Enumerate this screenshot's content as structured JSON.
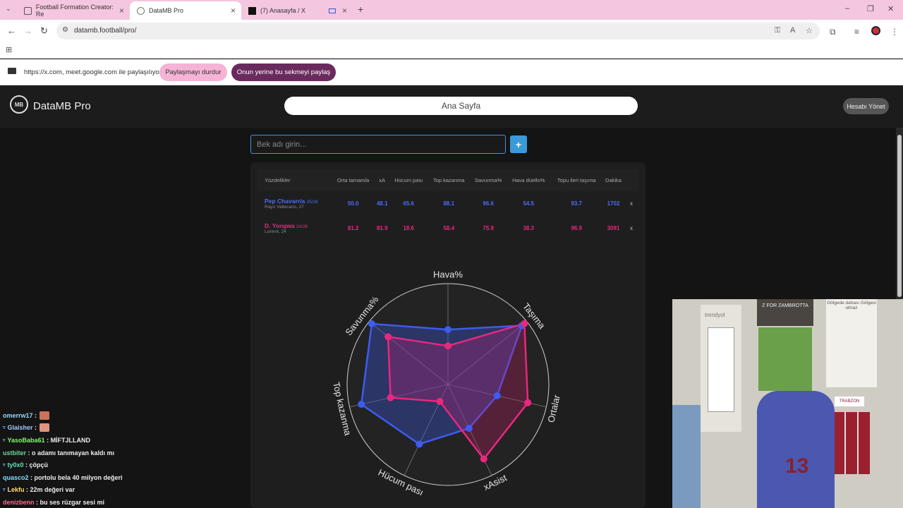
{
  "browser": {
    "tabs": [
      {
        "title": "Football Formation Creator: Re",
        "active": false
      },
      {
        "title": "DataMB Pro",
        "active": true
      },
      {
        "title": "(7) Anasayfa / X",
        "active": false
      }
    ],
    "url": "datamb.football/pro/",
    "share": {
      "message": "https://x.com, meet.google.com ile paylaşılıyor",
      "stop_label": "Paylaşmayı durdur",
      "share_this_label": "Onun yerine bu sekmeyi paylaş"
    }
  },
  "app": {
    "brand": "DataMB Pro",
    "logo_text": "MB",
    "home_label": "Ana Sayfa",
    "manage_label": "Hesabı Yönet",
    "search_placeholder": "Bek adı girin...",
    "add_label": "+"
  },
  "table": {
    "corner_label": "Yüzdelikler",
    "headers": [
      "Orta tamamla",
      "xA",
      "Hücum pası",
      "Top kazanma",
      "Savunma%",
      "Hava düello%",
      "Topu ileri taşıma",
      "Dakika"
    ],
    "players": [
      {
        "name": "Pep Chavarría",
        "season": "25/26",
        "club": "Rayo Vallecano, 27",
        "values": [
          "50.0",
          "48.1",
          "65.6",
          "88.1",
          "96.6",
          "54.5",
          "93.7",
          "1702"
        ],
        "color": "#4a6cff"
      },
      {
        "name": "D. Yongwa",
        "season": "24/26",
        "club": "Lorient, 24",
        "values": [
          "81.2",
          "81.9",
          "18.6",
          "58.4",
          "75.9",
          "38.3",
          "96.9",
          "3091"
        ],
        "color": "#e8287e"
      }
    ],
    "remove_label": "x"
  },
  "radar": {
    "axes": [
      "Hava%",
      "Taşıma",
      "Ortalar",
      "xAsist",
      "Hücum pası",
      "Top kazanma",
      "Savunma%"
    ]
  },
  "chat": [
    {
      "user": "omerrw17",
      "text": "",
      "color": "#9ad8ff",
      "emote": true,
      "badge": false
    },
    {
      "user": "Glaisher",
      "text": "",
      "color": "#a0c8ff",
      "emote": true,
      "badge": true
    },
    {
      "user": "YasoBaba61",
      "text": "MİFTJLLAND",
      "color": "#7dff6a",
      "emote": false,
      "badge": true
    },
    {
      "user": "ustbiter",
      "text": "o adamı tanımayan kaldı mı",
      "color": "#6ad6a0",
      "emote": false,
      "badge": false
    },
    {
      "user": "ty0x0",
      "text": "çöpçü",
      "color": "#66e0c0",
      "emote": false,
      "badge": true
    },
    {
      "user": "quasco2",
      "text": "portolu bela 40 milyon değeri",
      "color": "#7ddfff",
      "emote": false,
      "badge": false
    },
    {
      "user": "Lekfu",
      "text": "22m değeri var",
      "color": "#ffe070",
      "emote": false,
      "badge": true
    },
    {
      "user": "denizbenn",
      "text": "bu ses rüzgar sesi mi",
      "color": "#ff6a8a",
      "emote": false,
      "badge": false
    }
  ],
  "webcam": {
    "sign_text": "Z FOR ZAMBROTTA",
    "poster_text": "Gölgede dahası Gölgesi olmaz",
    "brand_text": "trendyol",
    "label_text": "TRABZON",
    "jersey_number": "13"
  }
}
